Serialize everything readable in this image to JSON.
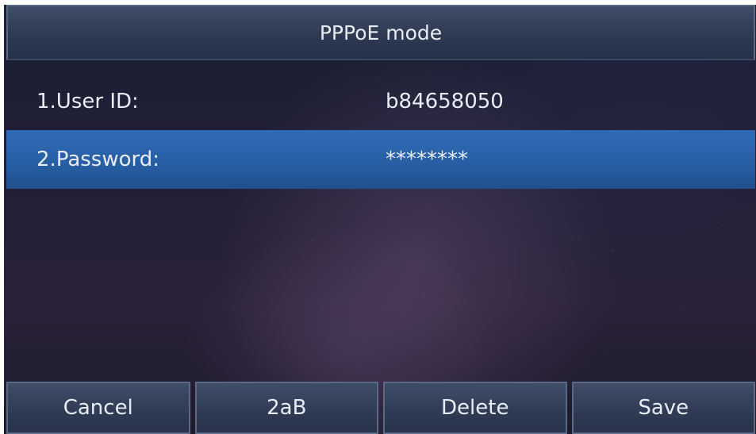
{
  "header": {
    "title": "PPPoE mode"
  },
  "fields": {
    "user_id": {
      "label": "1.User ID:",
      "value": "b84658050"
    },
    "password": {
      "label": "2.Password:",
      "value": "********"
    }
  },
  "softkeys": {
    "cancel": "Cancel",
    "input_mode": "2aB",
    "delete": "Delete",
    "save": "Save"
  },
  "colors": {
    "selected_row": "#2f6bb5",
    "bar": "#2e3a52",
    "text": "#e8ecf4"
  }
}
